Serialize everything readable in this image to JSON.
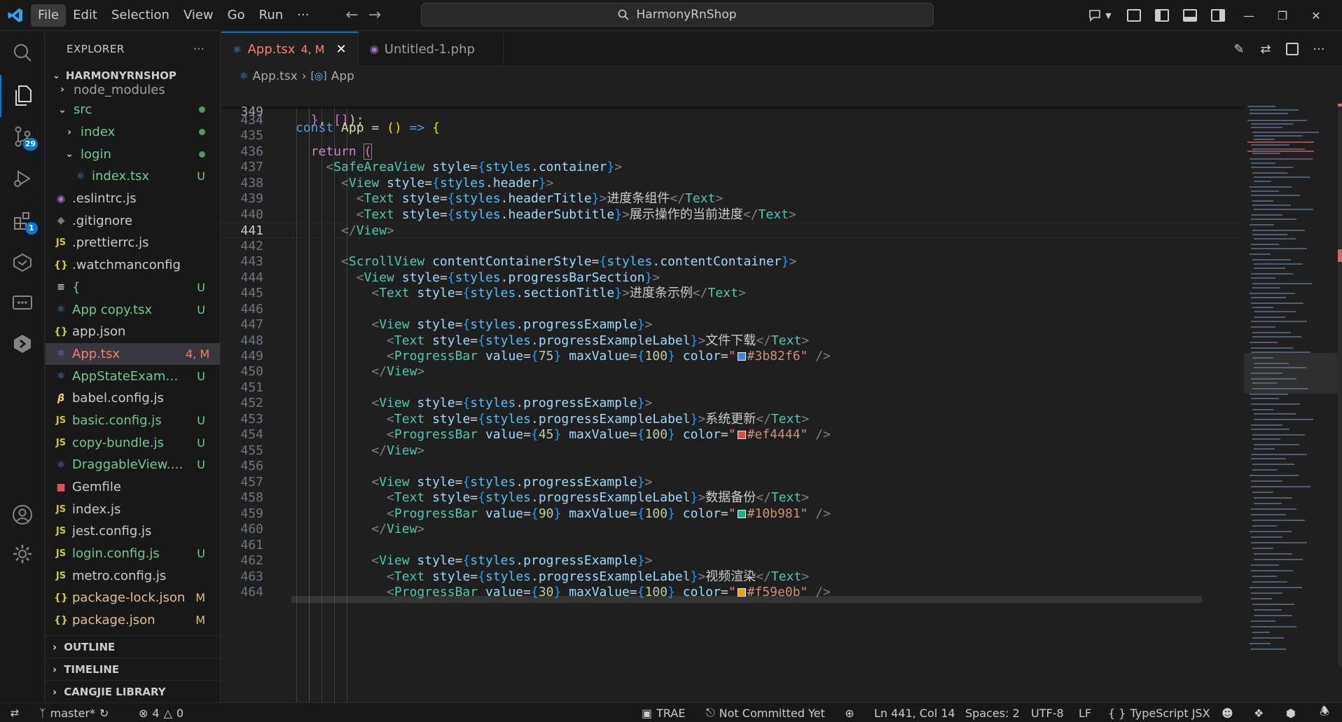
{
  "titlebar": {
    "menu": [
      "File",
      "Edit",
      "Selection",
      "View",
      "Go",
      "Run",
      "···"
    ],
    "search_text": "HarmonyRnShop"
  },
  "activity_badges": {
    "source_control": "29",
    "extensions": "1"
  },
  "explorer": {
    "title": "EXPLORER",
    "more": "···",
    "root": "HARMONYRNSHOP",
    "items": [
      {
        "name": "node_modules",
        "status": ""
      },
      {
        "name": "src",
        "status": ""
      },
      {
        "name": "index",
        "status": ""
      },
      {
        "name": "login",
        "status": ""
      },
      {
        "name": "index.tsx",
        "status": "U"
      },
      {
        "name": ".eslintrc.js",
        "status": ""
      },
      {
        "name": ".gitignore",
        "status": ""
      },
      {
        "name": ".prettierrc.js",
        "status": ""
      },
      {
        "name": ".watchmanconfig",
        "status": ""
      },
      {
        "name": "{",
        "status": "U"
      },
      {
        "name": "App copy.tsx",
        "status": "U"
      },
      {
        "name": "app.json",
        "status": ""
      },
      {
        "name": "App.tsx",
        "status": "4, M"
      },
      {
        "name": "AppStateExample....",
        "status": "U"
      },
      {
        "name": "babel.config.js",
        "status": ""
      },
      {
        "name": "basic.config.js",
        "status": "U"
      },
      {
        "name": "copy-bundle.js",
        "status": "U"
      },
      {
        "name": "DraggableView.tsx",
        "status": "U"
      },
      {
        "name": "Gemfile",
        "status": ""
      },
      {
        "name": "index.js",
        "status": ""
      },
      {
        "name": "jest.config.js",
        "status": ""
      },
      {
        "name": "login.config.js",
        "status": "U"
      },
      {
        "name": "metro.config.js",
        "status": ""
      },
      {
        "name": "package-lock.json",
        "status": "M"
      },
      {
        "name": "package.json",
        "status": "M"
      }
    ],
    "sections": [
      "OUTLINE",
      "TIMELINE",
      "CANGJIE LIBRARY"
    ]
  },
  "tabs": [
    {
      "label": "App.tsx",
      "badge": "4, M"
    },
    {
      "label": "Untitled-1.php",
      "badge": ""
    }
  ],
  "breadcrumb": [
    "App.tsx",
    "App"
  ],
  "sticky": {
    "line": "349"
  },
  "code": {
    "lines": [
      "434",
      "435",
      "436",
      "437",
      "438",
      "439",
      "440",
      "441",
      "442",
      "443",
      "444",
      "445",
      "446",
      "447",
      "448",
      "449",
      "450",
      "451",
      "452",
      "453",
      "454",
      "455",
      "456",
      "457",
      "458",
      "459",
      "460",
      "461",
      "462",
      "463",
      "464"
    ],
    "label_header_title": "进度条组件",
    "label_header_subtitle": "展示操作的当前进度",
    "label_section_title": "进度条示例",
    "examples": [
      {
        "label": "文件下载",
        "value": "75",
        "max": "100",
        "color": "#3b82f6"
      },
      {
        "label": "系统更新",
        "value": "45",
        "max": "100",
        "color": "#ef4444"
      },
      {
        "label": "数据备份",
        "value": "90",
        "max": "100",
        "color": "#10b981"
      },
      {
        "label": "视频渲染",
        "value": "30",
        "max": "100",
        "color": "#f59e0b"
      }
    ]
  },
  "statusbar": {
    "branch": "master*",
    "errors": "4",
    "warnings": "0",
    "trae": "TRAE",
    "commit": "Not Committed Yet",
    "position": "Ln 441, Col 14",
    "spaces": "Spaces: 2",
    "encoding": "UTF-8",
    "eol": "LF",
    "language": "TypeScript JSX"
  }
}
